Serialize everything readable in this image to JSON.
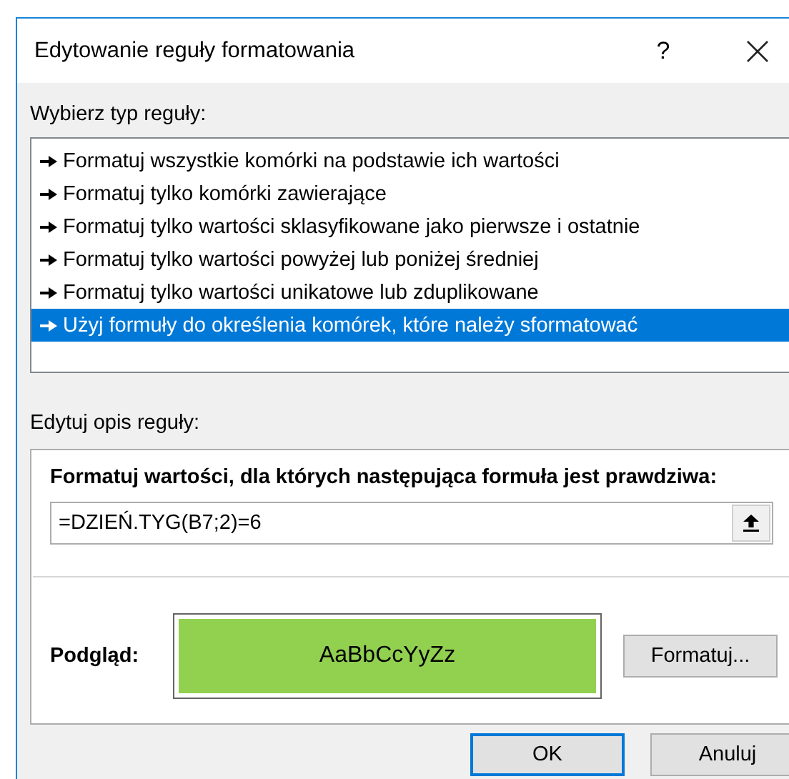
{
  "window": {
    "title": "Edytowanie reguły formatowania",
    "help": "?"
  },
  "rule_type": {
    "label": "Wybierz typ reguły:",
    "items": [
      {
        "label": "Formatuj wszystkie komórki na podstawie ich wartości",
        "selected": false
      },
      {
        "label": "Formatuj tylko komórki zawierające",
        "selected": false
      },
      {
        "label": "Formatuj tylko wartości sklasyfikowane jako pierwsze i ostatnie",
        "selected": false
      },
      {
        "label": "Formatuj tylko wartości powyżej lub poniżej średniej",
        "selected": false
      },
      {
        "label": "Formatuj tylko wartości unikatowe lub zduplikowane",
        "selected": false
      },
      {
        "label": "Użyj formuły do określenia komórek, które należy sformatować",
        "selected": true
      }
    ]
  },
  "description": {
    "label": "Edytuj opis reguły:",
    "heading": "Formatuj wartości, dla których następująca formuła jest prawdziwa:",
    "formula": "=DZIEŃ.TYG(B7;2)=6",
    "preview_label": "Podgląd:",
    "preview_text": "AaBbCcYyZz",
    "format_button": "Formatuj..."
  },
  "buttons": [
    "OK",
    "Anuluj"
  ]
}
